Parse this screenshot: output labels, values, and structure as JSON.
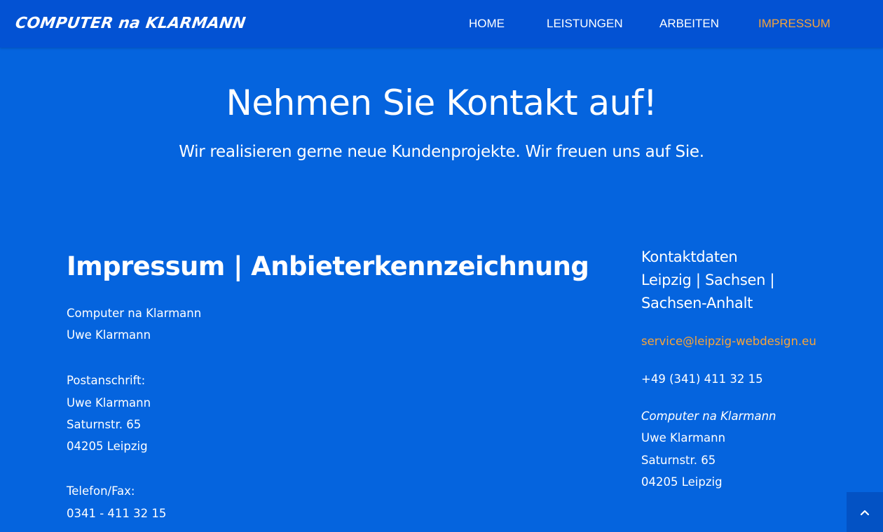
{
  "header": {
    "logo": "COMPUTER na KLARMANN",
    "nav": [
      "HOME",
      "LEISTUNGEN",
      "ARBEITEN",
      "IMPRESSUM"
    ],
    "active_nav": "IMPRESSUM",
    "active_color": "#f6a43a"
  },
  "hero": {
    "title": "Nehmen Sie Kontakt auf!",
    "subtitle": "Wir realisieren gerne neue Kundenprojekte. Wir freuen uns auf Sie."
  },
  "impressum": {
    "heading": "Impressum | Anbieterkennzeichnung",
    "company": "Computer na Klarmann",
    "owner": "Uwe Klarmann",
    "postal_label": "Postanschrift:",
    "postal_name": "Uwe Klarmann",
    "postal_street": "Saturnstr. 65",
    "postal_city": "04205 Leipzig",
    "phone_label": "Telefon/Fax:",
    "phone": "0341 - 411 32 15"
  },
  "sidebar": {
    "heading_line1": "Kontaktdaten",
    "heading_line2": "Leipzig | Sachsen |",
    "heading_line3": "Sachsen-Anhalt",
    "email": "service@leipzig-webdesign.eu",
    "phone": "+49 (341) 411 32 15",
    "company": "Computer na Klarmann",
    "name": "Uwe Klarmann",
    "street": "Saturnstr. 65",
    "city": "04205 Leipzig"
  },
  "colors": {
    "background": "#0564de",
    "header": "#0352d3",
    "accent": "#f6a43a"
  },
  "icons": {
    "scroll_top": "chevron-up-icon"
  }
}
